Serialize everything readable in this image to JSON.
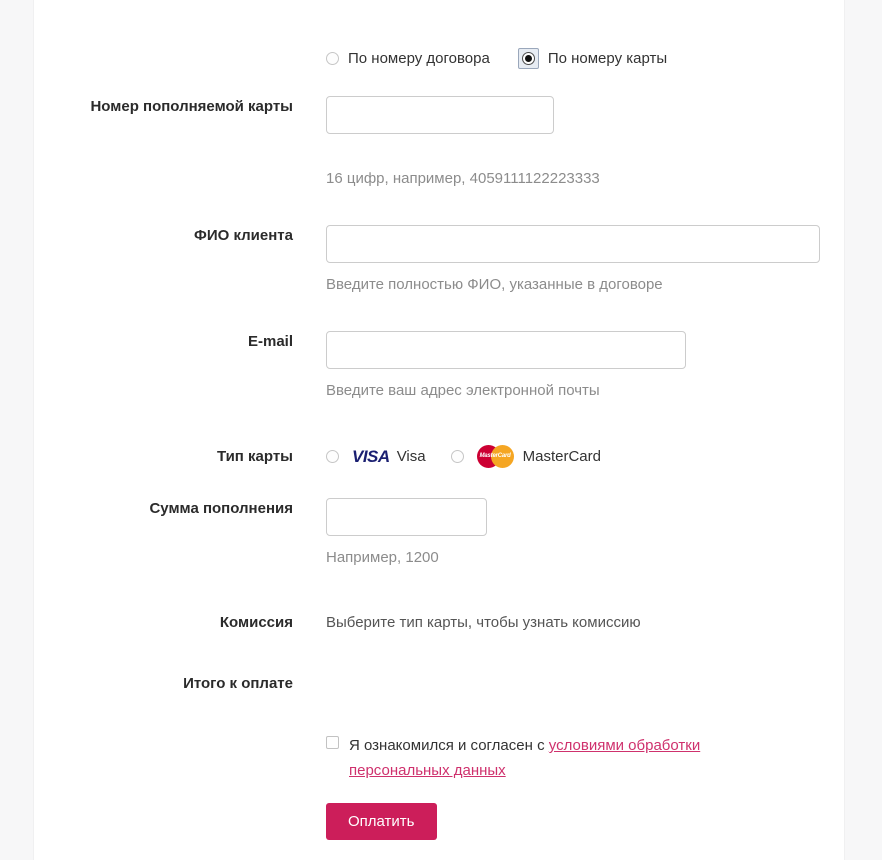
{
  "page": {
    "background_color": "#f7f7f8",
    "container_color": "#ffffff",
    "accent_color": "#cc1e5a",
    "link_color": "#cf316d"
  },
  "method_选择": null,
  "method_radios": {
    "options": [
      {
        "label": "По номеру договора",
        "checked": false,
        "focused": false
      },
      {
        "label": "По номеру карты",
        "checked": true,
        "focused": true
      }
    ]
  },
  "fields": {
    "card_number": {
      "label": "Номер пополняемой карты",
      "value": "",
      "placeholder": "",
      "hint": "16 цифр, например, 4059111122223333"
    },
    "full_name": {
      "label": "ФИО клиента",
      "value": "",
      "placeholder": "",
      "hint": "Введите полностью ФИО, указанные в договоре"
    },
    "email": {
      "label": "E-mail",
      "value": "",
      "placeholder": "",
      "hint": "Введите ваш адрес электронной почты"
    },
    "card_type": {
      "label": "Тип карты",
      "options": [
        {
          "label": "Visa",
          "logo": "visa-logo",
          "checked": false
        },
        {
          "label": "MasterCard",
          "logo": "mastercard-logo",
          "checked": false
        }
      ]
    },
    "amount": {
      "label": "Сумма пополнения",
      "value": "",
      "placeholder": "",
      "hint": "Например, 1200"
    },
    "commission": {
      "label": "Комиссия",
      "value": "Выберите тип карты, чтобы узнать комиссию"
    },
    "total": {
      "label": "Итого к оплате",
      "value": ""
    }
  },
  "agreement": {
    "checked": false,
    "text_before": "Я ознакомился и согласен с ",
    "link_text": "условиями обработки персональных данных"
  },
  "submit": {
    "label": "Оплатить"
  },
  "logos": {
    "visa_text": "VISA",
    "mastercard_text": "MasterCard"
  }
}
